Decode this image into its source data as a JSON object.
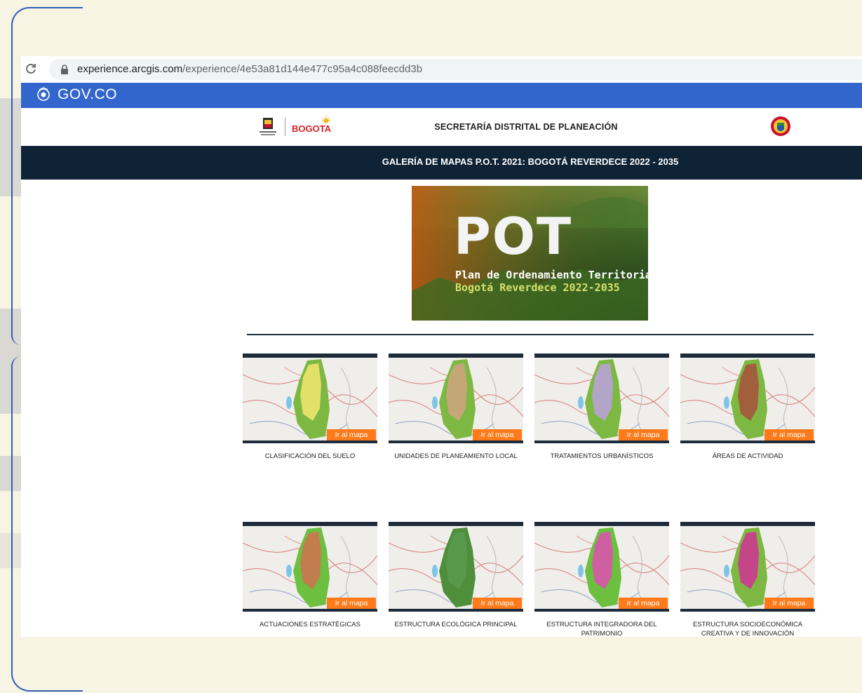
{
  "browser": {
    "url_host": "experience.arcgis.com",
    "url_path": "/experience/4e53a81d144e477c95a4c088feecdd3b"
  },
  "gov_bar": {
    "label": "GOV.CO"
  },
  "header": {
    "bogota_logo": "BOGOTA",
    "title": "SECRETARÍA DISTRITAL DE PLANEACIÓN"
  },
  "galeria": {
    "title": "GALERÍA DE MAPAS P.O.T. 2021: BOGOTÁ REVERDECE 2022 - 2035"
  },
  "banner": {
    "title": "POT",
    "subtitle_line1": "Plan de Ordenamiento Territorial",
    "subtitle_line2": "Bogotá Reverdece 2022-2035"
  },
  "cards": [
    {
      "label": "CLASIFICACIÓN DEL SUELO",
      "button": "Ir al mapa"
    },
    {
      "label": "UNIDADES DE PLANEAMIENTO LOCAL",
      "button": "Ir al mapa"
    },
    {
      "label": "TRATAMIENTOS URBANÍSTICOS",
      "button": "Ir al mapa"
    },
    {
      "label": "ÁREAS DE ACTIVIDAD",
      "button": "Ir al mapa"
    },
    {
      "label": "ACTUACIONES ESTRATÉGICAS",
      "button": "Ir al mapa"
    },
    {
      "label": "ESTRUCTURA ECOLÓGICA PRINCIPAL",
      "button": "Ir al mapa"
    },
    {
      "label": "ESTRUCTURA INTEGRADORA DEL PATRIMONIO",
      "button": "Ir al mapa"
    },
    {
      "label": "ESTRUCTURA SOCIOECONÓMICA CREATIVA Y DE INNOVACIÓN",
      "button": "Ir al mapa"
    }
  ],
  "colors": {
    "gov_blue": "#3366cc",
    "navy_bar": "#0f2336",
    "orange_button": "#ff7a1a",
    "slide_bg": "#f8f4e3",
    "frame_blue": "#2d5fb5"
  },
  "icons": [
    "reload-icon",
    "lock-icon",
    "gov-shield-icon",
    "alcaldia-logo-icon",
    "coat-of-arms-icon"
  ]
}
